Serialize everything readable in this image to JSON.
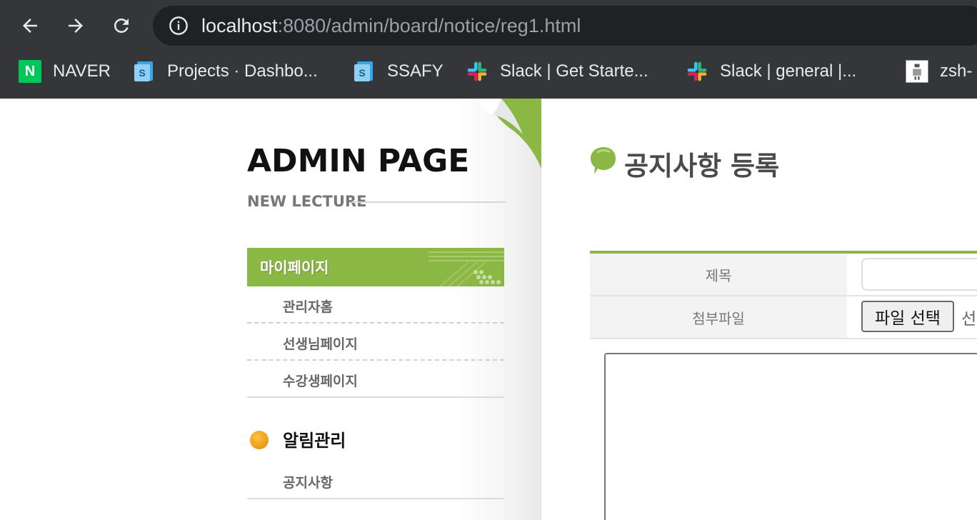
{
  "browser": {
    "url_host": "localhost",
    "url_path": ":8080/admin/board/notice/reg1.html",
    "bookmarks": [
      {
        "label": "NAVER",
        "icon": "naver-icon"
      },
      {
        "label": "Projects · Dashbo...",
        "icon": "document-icon"
      },
      {
        "label": "SSAFY",
        "icon": "document-icon"
      },
      {
        "label": "Slack | Get Starte...",
        "icon": "slack-icon"
      },
      {
        "label": "Slack | general |...",
        "icon": "slack-icon"
      },
      {
        "label": "zsh-",
        "icon": "image-icon"
      }
    ],
    "naver_glyph": "N",
    "doc_glyph": "S"
  },
  "sidebar": {
    "title": "ADMIN PAGE",
    "subtitle": "NEW LECTURE",
    "active_menu": "마이페이지",
    "items": [
      "관리자홈",
      "선생님페이지",
      "수강생페이지"
    ],
    "section_title": "알림관리",
    "section_items": [
      "공지사항"
    ]
  },
  "content": {
    "title": "공지사항 등록",
    "form": {
      "title_label": "제목",
      "title_value": "",
      "attach_label": "첨부파일",
      "file_button": "파일 선택",
      "file_status": "선"
    }
  },
  "colors": {
    "accent_green": "#8bb744",
    "chrome_bg": "#35363a",
    "omnibox_bg": "#202124",
    "bullet_orange": "#f0a21c"
  }
}
